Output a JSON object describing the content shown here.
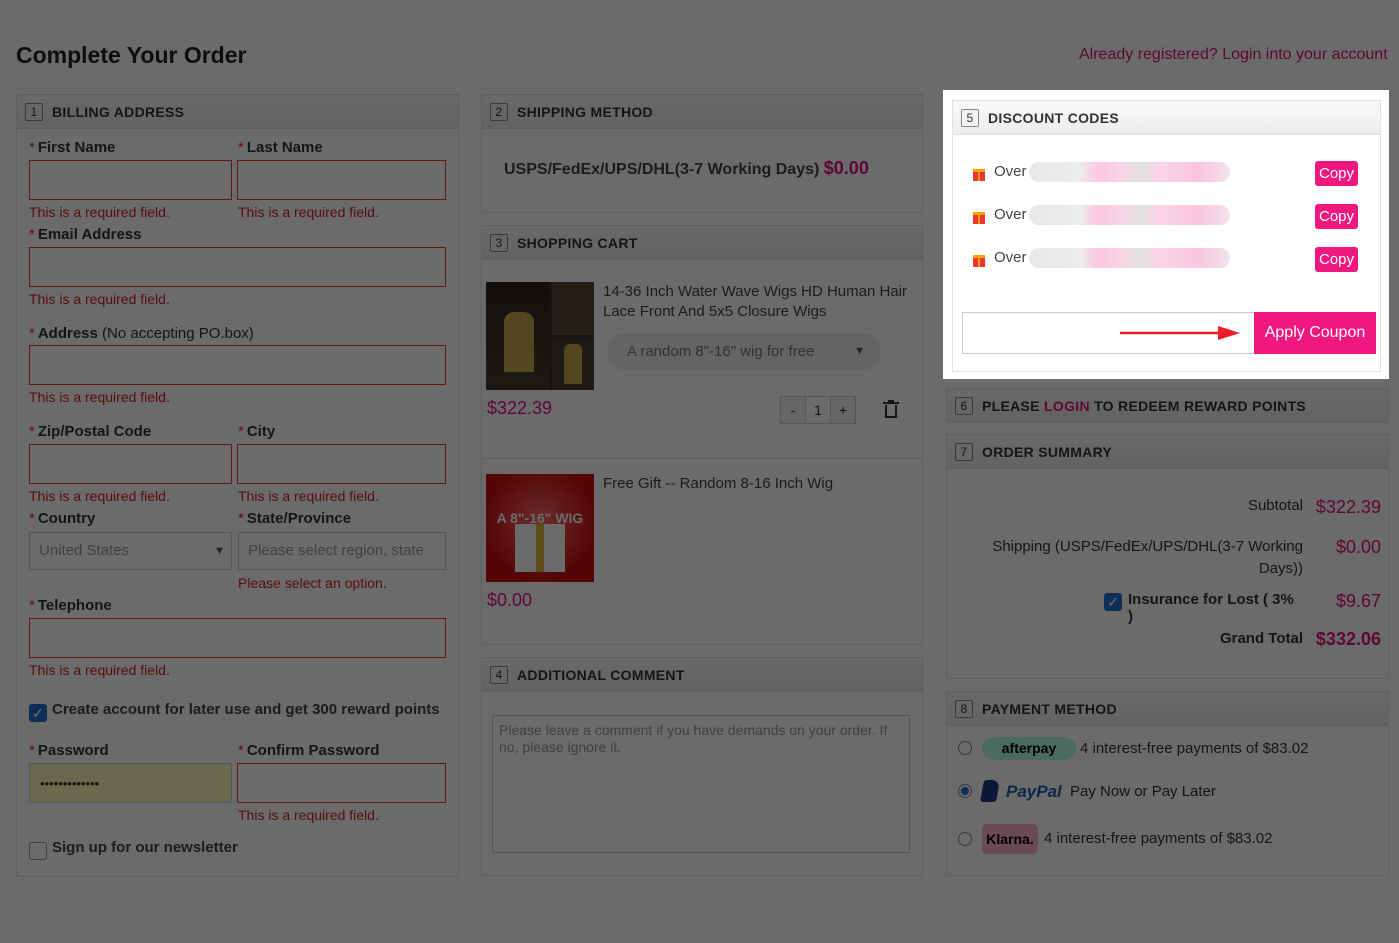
{
  "page": {
    "title": "Complete Your Order",
    "login_link": "Already registered? Login into your account"
  },
  "billing": {
    "number": "1",
    "heading": "BILLING ADDRESS",
    "first_name": "First Name",
    "last_name": "Last Name",
    "email": "Email Address",
    "address": "Address",
    "address_note": "(No accepting PO.box)",
    "zip": "Zip/Postal Code",
    "city": "City",
    "country": "Country",
    "country_value": "United States",
    "state": "State/Province",
    "state_placeholder": "Please select region, state",
    "state_error": "Please select an option.",
    "telephone": "Telephone",
    "required_error": "This is a required field.",
    "create_account": "Create account for later use and get 300 reward points",
    "password": "Password",
    "password_value": "•••••••••••••",
    "confirm_password": "Confirm Password",
    "newsletter": "Sign up for our newsletter",
    "star": "*"
  },
  "shipping": {
    "number": "2",
    "heading": "SHIPPING METHOD",
    "method": "USPS/FedEx/UPS/DHL(3-7 Working Days)",
    "price": "$0.00"
  },
  "cart": {
    "number": "3",
    "heading": "SHOPPING CART",
    "items": [
      {
        "name": "14-36 Inch Water Wave Wigs HD Human Hair Lace Front And 5x5 Closure Wigs",
        "option": "A random 8\"-16\" wig for free",
        "price": "$322.39",
        "qty": "1"
      },
      {
        "name": "Free Gift -- Random 8-16 Inch Wig",
        "image_text": "A 8\"-16\" WIG",
        "price": "$0.00"
      }
    ],
    "minus": "-",
    "plus": "+"
  },
  "comment": {
    "number": "4",
    "heading": "ADDITIONAL COMMENT",
    "placeholder": "Please leave a comment if you have demands on your order. If no, please ignore it."
  },
  "discount": {
    "number": "5",
    "heading": "DISCOUNT CODES",
    "codes": [
      {
        "label": "Over",
        "copy": "Copy"
      },
      {
        "label": "Over",
        "copy": "Copy"
      },
      {
        "label": "Over",
        "copy": "Copy"
      }
    ],
    "apply_label": "Apply Coupon"
  },
  "reward": {
    "number": "6",
    "prefix": "PLEASE",
    "login": "LOGIN",
    "suffix": "TO REDEEM REWARD POINTS"
  },
  "summary": {
    "number": "7",
    "heading": "ORDER SUMMARY",
    "subtotal_label": "Subtotal",
    "subtotal": "$322.39",
    "shipping_label": "Shipping (USPS/FedEx/UPS/DHL(3-7 Working Days))",
    "shipping": "$0.00",
    "insurance_label": "Insurance for Lost ( 3% )",
    "insurance": "$9.67",
    "grand_label": "Grand Total",
    "grand": "$332.06"
  },
  "payment": {
    "number": "8",
    "heading": "PAYMENT METHOD",
    "options": [
      {
        "brand": "afterpay",
        "text": "4 interest-free payments of $83.02"
      },
      {
        "brand": "PayPal",
        "text": "Pay Now or Pay Later"
      },
      {
        "brand": "Klarna.",
        "text": "4 interest-free payments of $83.02"
      }
    ]
  },
  "colors": {
    "accent": "#e2127a",
    "error": "#d4202a",
    "checkbox": "#1f6fd0"
  }
}
